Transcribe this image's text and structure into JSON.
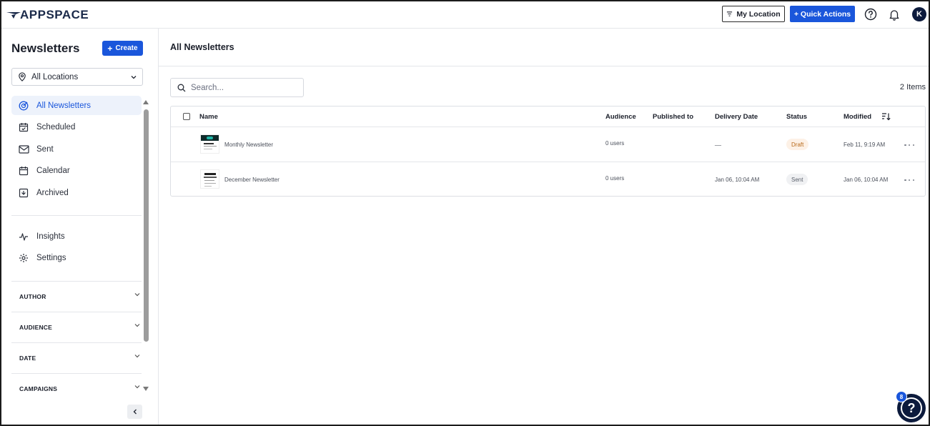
{
  "brand": {
    "logo_text": "APPSPACE",
    "accent": "#1a56db",
    "dark": "#0c1a3c"
  },
  "topbar": {
    "my_location_label": "My Location",
    "quick_actions_label": "+ Quick Actions",
    "help_icon": "help-circle-icon",
    "bell_icon": "bell-icon",
    "avatar_initial": "K"
  },
  "sidebar": {
    "title": "Newsletters",
    "create_label": "Create",
    "location_select": {
      "value": "All Locations"
    },
    "nav": [
      {
        "label": "All Newsletters",
        "icon": "target-icon",
        "active": true
      },
      {
        "label": "Scheduled",
        "icon": "calendar-check-icon"
      },
      {
        "label": "Sent",
        "icon": "envelope-icon"
      },
      {
        "label": "Calendar",
        "icon": "calendar-icon"
      },
      {
        "label": "Archived",
        "icon": "archive-icon"
      }
    ],
    "nav2": [
      {
        "label": "Insights",
        "icon": "pulse-icon"
      },
      {
        "label": "Settings",
        "icon": "gear-icon"
      }
    ],
    "filters": [
      "AUTHOR",
      "AUDIENCE",
      "DATE",
      "CAMPAIGNS"
    ]
  },
  "main": {
    "title": "All Newsletters",
    "search": {
      "placeholder": "Search..."
    },
    "item_count": "2 Items",
    "columns": {
      "name": "Name",
      "audience": "Audience",
      "published_to": "Published to",
      "delivery_date": "Delivery Date",
      "status": "Status",
      "modified": "Modified"
    },
    "rows": [
      {
        "name": "Monthly Newsletter",
        "audience": "0 users",
        "published_to": "",
        "delivery_date": "__",
        "status": "Draft",
        "modified": "Feb 11, 9:19 AM"
      },
      {
        "name": "December Newsletter",
        "audience": "0 users",
        "published_to": "",
        "delivery_date": "Jan 06, 10:04 AM",
        "status": "Sent",
        "modified": "Jan 06, 10:04 AM"
      }
    ]
  },
  "help_fab": {
    "badge_count": "8",
    "glyph": "?"
  }
}
